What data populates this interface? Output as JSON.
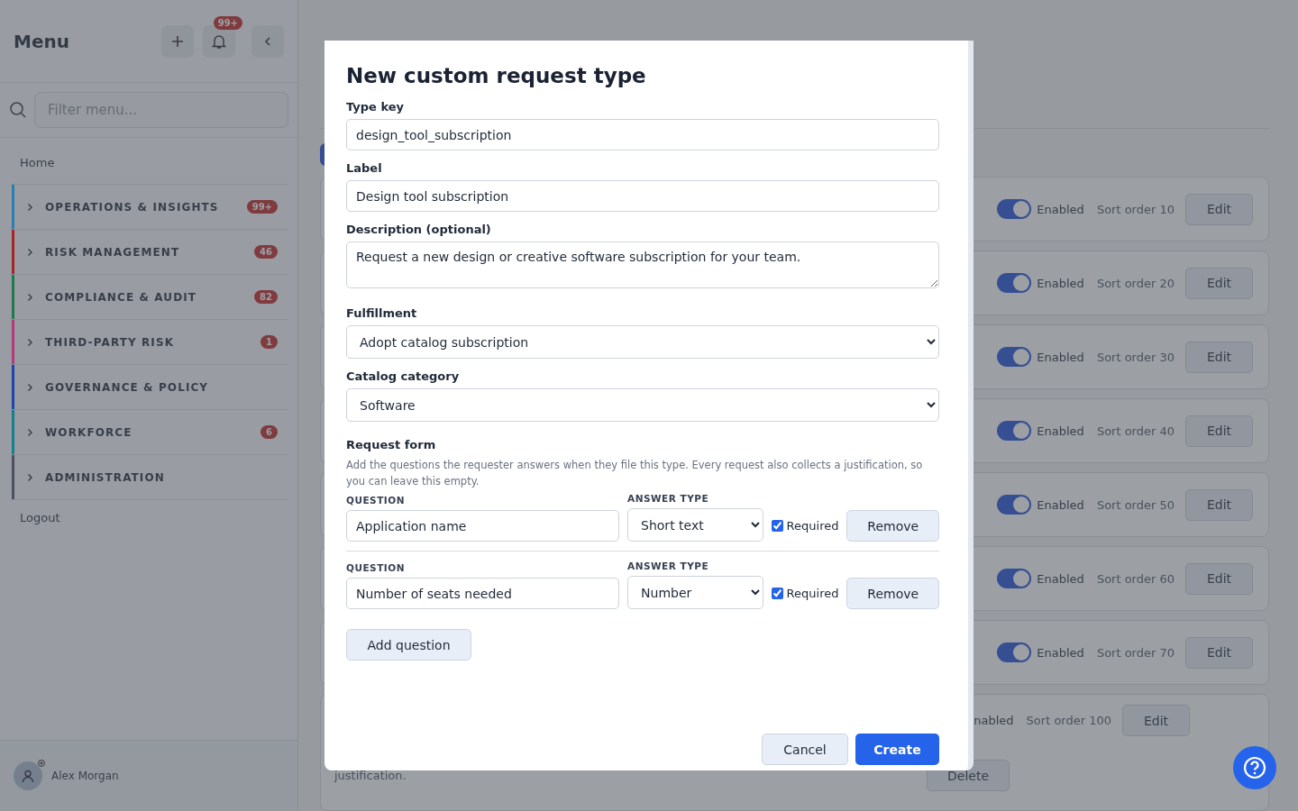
{
  "sidebar": {
    "title": "Menu",
    "notifications_badge": "99+",
    "filter": {
      "placeholder": "Filter menu..."
    },
    "home": "Home",
    "groups": [
      {
        "label": "OPERATIONS & INSIGHTS",
        "color": "#2a7fae",
        "badge": "99+",
        "expanded": false
      },
      {
        "label": "RISK MANAGEMENT",
        "color": "#a82424",
        "badge": "46",
        "expanded": false
      },
      {
        "label": "COMPLIANCE & AUDIT",
        "color": "#1f7a47",
        "badge": "82",
        "expanded": false
      },
      {
        "label": "THIRD-PARTY RISK",
        "color": "#b23a78",
        "badge": "1",
        "expanded": false
      },
      {
        "label": "GOVERNANCE & POLICY",
        "color": "#1f44b0",
        "expanded": false
      },
      {
        "label": "WORKFORCE",
        "color": "#147f8a",
        "badge": "6",
        "expanded": false
      },
      {
        "label": "ADMINISTRATION",
        "color": "#4b5060",
        "expanded": false
      }
    ],
    "logout": "Logout",
    "user": "Alex Morgan"
  },
  "page": {
    "rows": [
      {
        "on": true,
        "status": "Enabled",
        "sort": "Sort order 10",
        "edit": "Edit"
      },
      {
        "on": true,
        "status": "Enabled",
        "sort": "Sort order 20",
        "edit": "Edit"
      },
      {
        "on": true,
        "status": "Enabled",
        "sort": "Sort order 30",
        "edit": "Edit"
      },
      {
        "on": true,
        "status": "Enabled",
        "sort": "Sort order 40",
        "edit": "Edit"
      },
      {
        "on": true,
        "status": "Enabled",
        "sort": "Sort order 50",
        "edit": "Edit"
      },
      {
        "on": true,
        "status": "Enabled",
        "sort": "Sort order 60",
        "edit": "Edit"
      },
      {
        "on": true,
        "status": "Enabled",
        "sort": "Sort order 70",
        "edit": "Edit"
      }
    ],
    "last_row": {
      "status": "nabled",
      "sort": "Sort order 100",
      "edit": "Edit",
      "description": "justification.",
      "delete": "Delete"
    }
  },
  "modal": {
    "title": "New custom request type",
    "type_key": {
      "label": "Type key",
      "value": "design_tool_subscription"
    },
    "label": {
      "label": "Label",
      "value": "Design tool subscription"
    },
    "description": {
      "label": "Description (optional)",
      "value": "Request a new design or creative software subscription for your team."
    },
    "fulfillment": {
      "label": "Fulfillment",
      "value": "Adopt catalog subscription"
    },
    "catalog_category": {
      "label": "Catalog category",
      "value": "Software"
    },
    "request_form": {
      "title": "Request form",
      "help": "Add the questions the requester answers when they file this type. Every request also collects a justification, so you can leave this empty.",
      "questions": [
        {
          "question_label": "QUESTION",
          "question": "Application name",
          "type_label": "ANSWER TYPE",
          "type": "Short text",
          "required": true,
          "required_label": "Required",
          "remove": "Remove"
        },
        {
          "question_label": "QUESTION",
          "question": "Number of seats needed",
          "type_label": "ANSWER TYPE",
          "type": "Number",
          "required": true,
          "required_label": "Required",
          "remove": "Remove"
        }
      ],
      "add": "Add question"
    },
    "cancel": "Cancel",
    "create": "Create"
  }
}
